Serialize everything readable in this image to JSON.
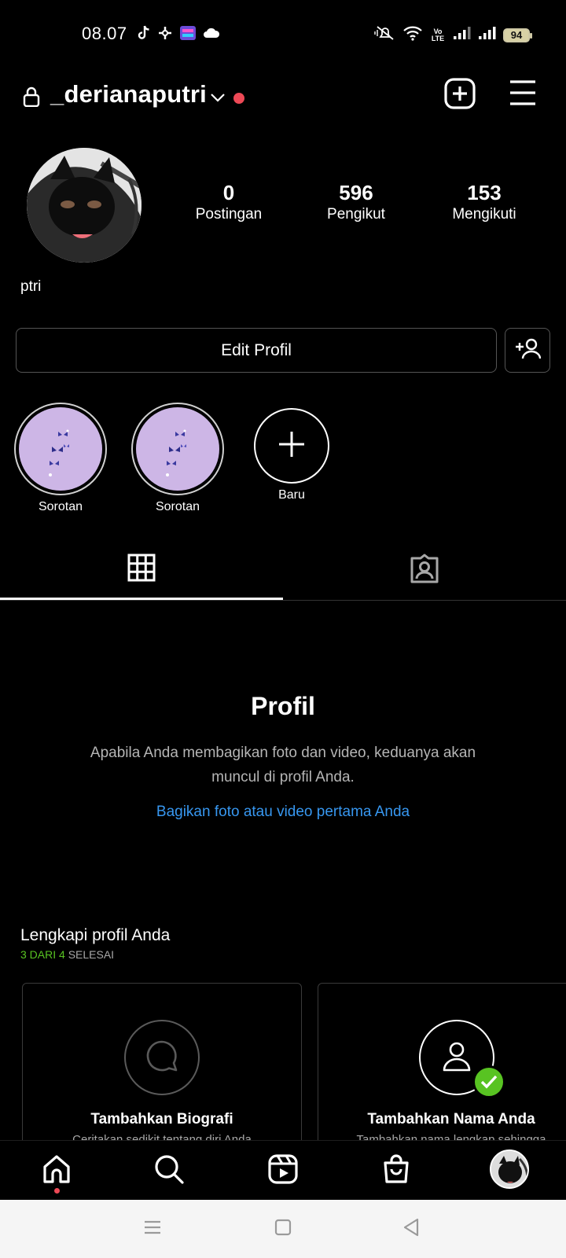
{
  "status_bar": {
    "time": "08.07",
    "battery": "94",
    "volte_top": "Vo",
    "volte_bottom": "LTE"
  },
  "header": {
    "username": "_derianaputri"
  },
  "profile": {
    "display_name": "ptri",
    "stats": [
      {
        "value": "0",
        "label": "Postingan"
      },
      {
        "value": "596",
        "label": "Pengikut"
      },
      {
        "value": "153",
        "label": "Mengikuti"
      }
    ],
    "edit_button": "Edit Profil"
  },
  "highlights": [
    {
      "label": "Sorotan"
    },
    {
      "label": "Sorotan"
    }
  ],
  "new_highlight": {
    "label": "Baru"
  },
  "empty_state": {
    "title": "Profil",
    "text": "Apabila Anda membagikan foto dan video, keduanya akan muncul di profil Anda.",
    "link": "Bagikan foto atau video pertama Anda"
  },
  "complete_profile": {
    "title": "Lengkapi profil Anda",
    "progress_done": "3 DARI 4",
    "progress_label": "SELESAI",
    "cards": [
      {
        "title": "Tambahkan Biografi",
        "subtitle": "Ceritakan sedikit tentang diri Anda"
      },
      {
        "title": "Tambahkan Nama Anda",
        "subtitle": "Tambahkan nama lengkap sehingga"
      }
    ]
  },
  "colors": {
    "accent_link": "#3797f0",
    "notification_dot": "#ed4956",
    "complete_green": "#58c322",
    "highlight_bg": "#cdb6e6"
  },
  "icons": {
    "header": [
      "lock-icon",
      "chevron-down-icon",
      "add-post-icon",
      "menu-icon"
    ],
    "tabs": [
      "grid-icon",
      "tagged-icon"
    ],
    "bottom_nav": [
      "home-icon",
      "search-icon",
      "reels-icon",
      "shop-icon",
      "profile-avatar"
    ],
    "system_nav": [
      "recents-icon",
      "home-square-icon",
      "back-icon"
    ]
  }
}
